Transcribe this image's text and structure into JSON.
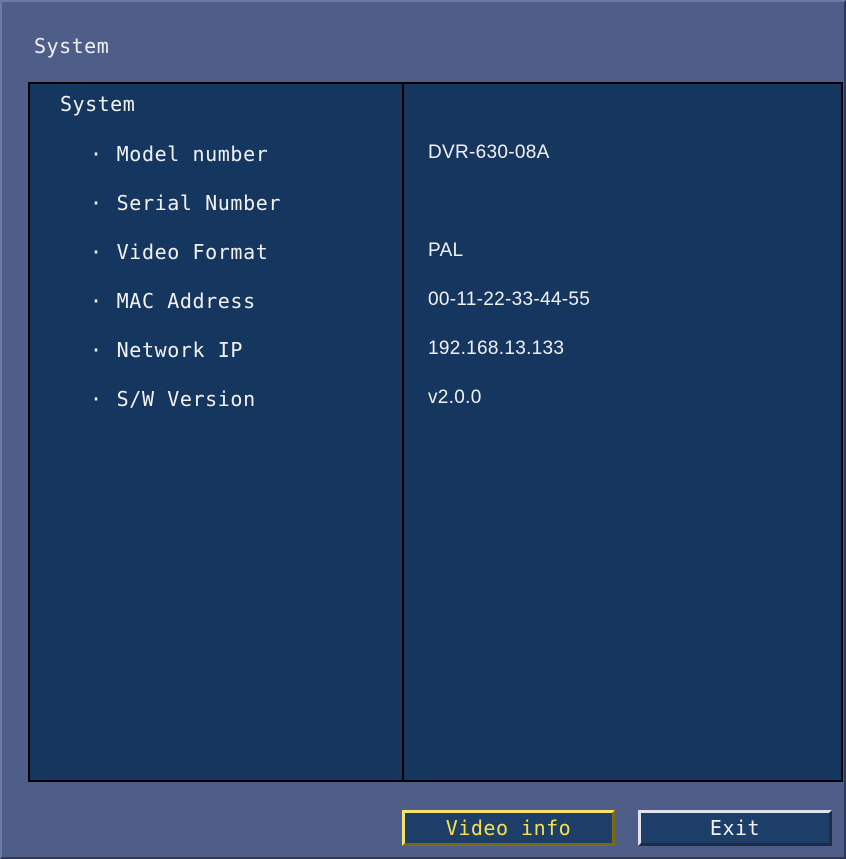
{
  "window": {
    "title": "System"
  },
  "panel": {
    "section_label": "System",
    "rows": [
      {
        "label": "Model number",
        "value": "DVR-630-08A"
      },
      {
        "label": "Serial Number",
        "value": ""
      },
      {
        "label": "Video Format",
        "value": "PAL"
      },
      {
        "label": "MAC Address",
        "value": "00-11-22-33-44-55"
      },
      {
        "label": "Network IP",
        "value": "192.168.13.133"
      },
      {
        "label": "S/W Version",
        "value": "v2.0.0"
      }
    ]
  },
  "buttons": {
    "video_info": "Video info",
    "exit": "Exit"
  },
  "colors": {
    "frame_background": "#4f5e88",
    "panel_background": "#15365e",
    "focus_highlight": "#f4e14a"
  }
}
